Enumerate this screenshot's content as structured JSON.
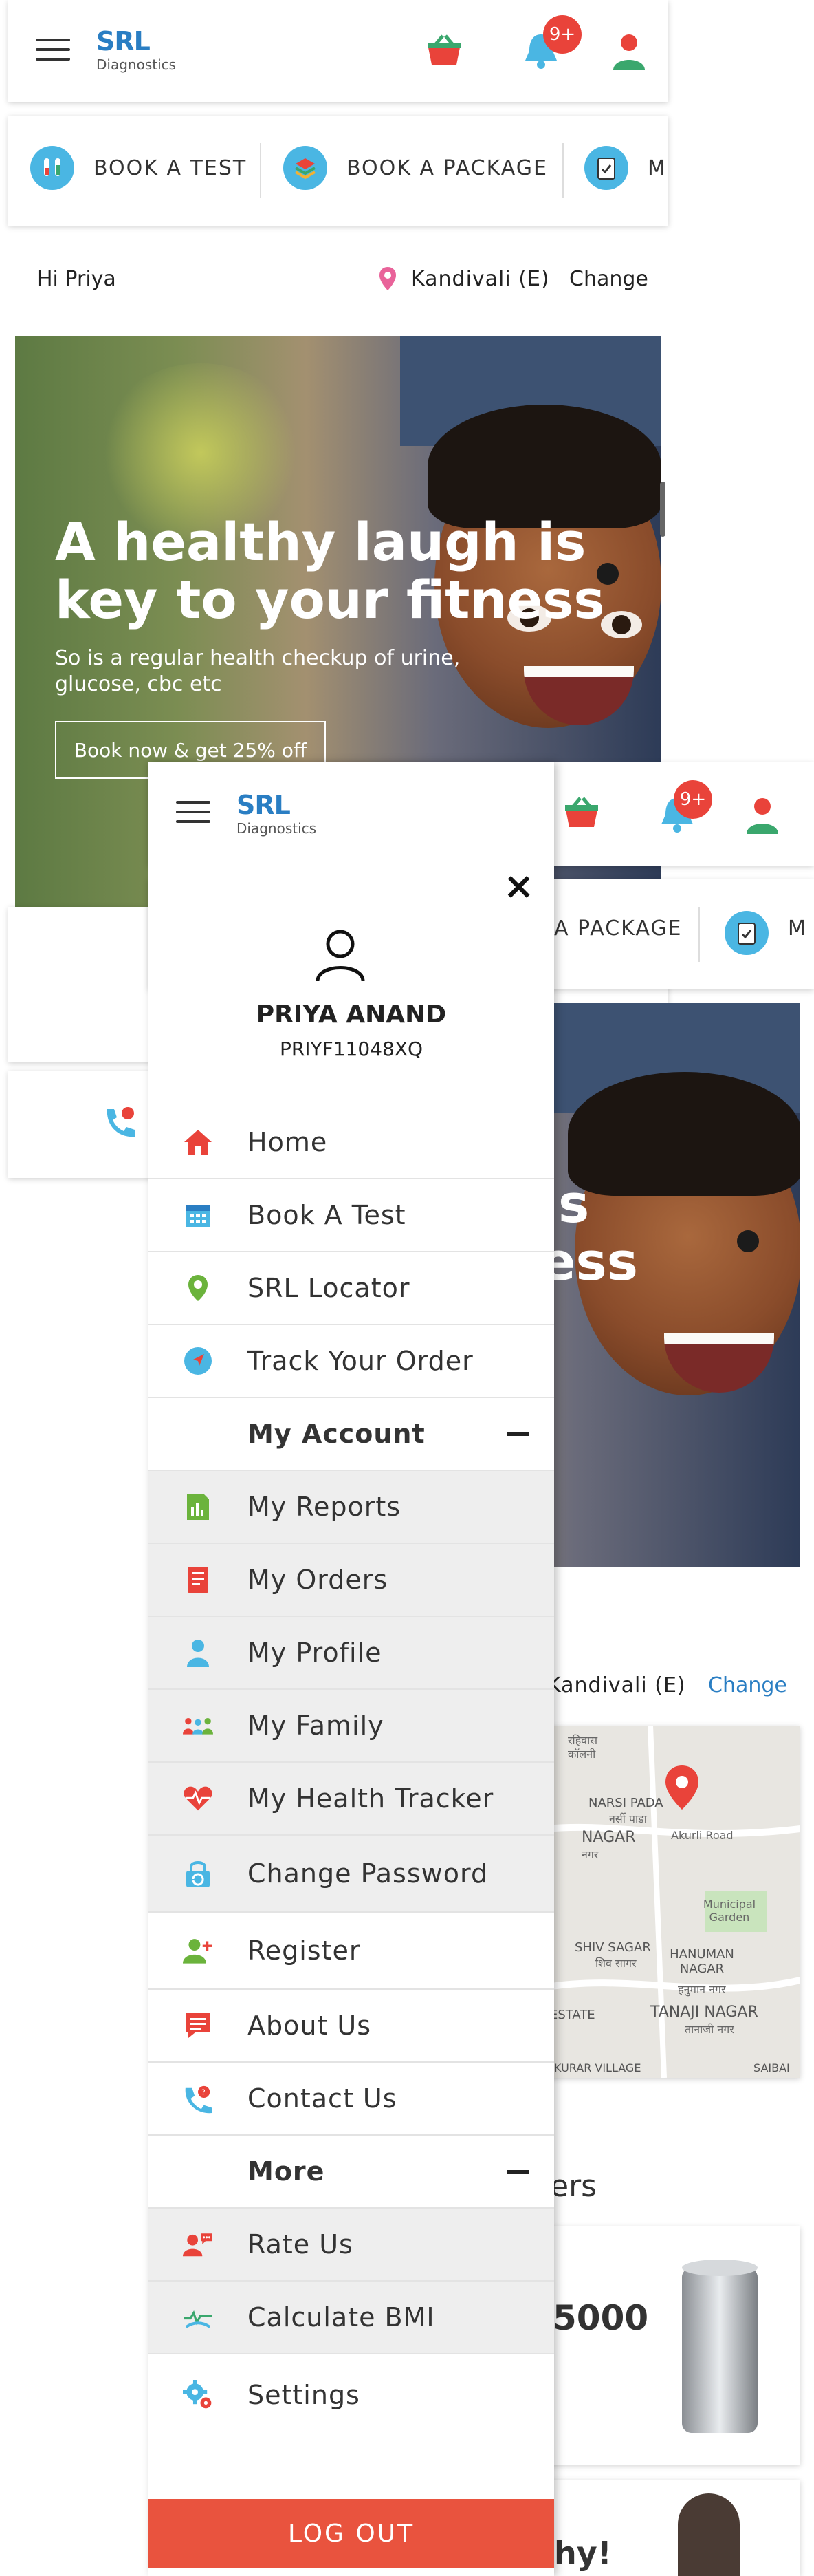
{
  "header": {
    "logo_main": "SRL",
    "logo_sub": "Diagnostics",
    "notification_badge": "9+"
  },
  "quick_links": [
    {
      "label": "BOOK A TEST",
      "icon": "test-tubes-icon"
    },
    {
      "label": "BOOK A PACKAGE",
      "icon": "package-icon"
    },
    {
      "label": "M",
      "icon": "clipboard-icon"
    }
  ],
  "greeting": {
    "text": "Hi Priya",
    "location": "Kandivali (E)",
    "change_label": "Change"
  },
  "hero": {
    "title_line1": "A healthy laugh is",
    "title_line2": "key to your fitness",
    "subtitle_line1": "So is a regular health checkup of urine,",
    "subtitle_line2": "glucose, cbc etc",
    "button_label": "Book now & get 25% off"
  },
  "background_screen": {
    "quick_link_partial": "A PACKAGE",
    "quick_link_partial2": "M",
    "hero_partial1": "is",
    "hero_partial2": "ess",
    "location": "Kandivali (E)",
    "change_label": "Change",
    "map_labels": {
      "narsi_pada": "NARSI PADA",
      "narsi_pada_hi": "नर्सी पाडा",
      "akurli_road": "Akurli Road",
      "nagar": "NAGAR",
      "nagar_hi": "नगर",
      "municipal_garden": "Municipal Garden",
      "shiv_sagar": "SHIV SAGAR",
      "shiv_sagar_hi": "शिव सागर",
      "hanuman_nagar": "HANUMAN NAGAR",
      "hanuman_nagar_hi": "हनुमान नगर",
      "estate": "ESTATE",
      "tanaji_nagar": "TANAJI NAGAR",
      "tanaji_nagar_hi": "तानाजी नगर",
      "kurar_village": "KURAR VILLAGE",
      "saibai": "SAIBAI",
      "colony": "कॉलनी",
      "top_hi": "रहिवास"
    },
    "offers_partial": "ers",
    "offer_amount": "5000",
    "bottom_partial": "hy!"
  },
  "drawer": {
    "close_label": "×",
    "user_name": "PRIYA ANAND",
    "user_id": "PRIYF11048XQ",
    "menu": [
      {
        "label": "Home",
        "icon": "home-icon"
      },
      {
        "label": "Book A Test",
        "icon": "calendar-icon"
      },
      {
        "label": "SRL Locator",
        "icon": "location-pin-icon"
      },
      {
        "label": "Track Your Order",
        "icon": "navigation-icon"
      }
    ],
    "my_account_label": "My Account",
    "account_items": [
      {
        "label": "My Reports",
        "icon": "reports-icon"
      },
      {
        "label": "My Orders",
        "icon": "orders-icon"
      },
      {
        "label": "My Profile",
        "icon": "profile-icon"
      },
      {
        "label": "My Family",
        "icon": "family-icon"
      },
      {
        "label": "My Health Tracker",
        "icon": "health-tracker-icon"
      },
      {
        "label": "Change Password",
        "icon": "change-password-icon"
      }
    ],
    "other_items": [
      {
        "label": "Register",
        "icon": "register-icon"
      },
      {
        "label": "About Us",
        "icon": "about-icon"
      },
      {
        "label": "Contact Us",
        "icon": "contact-icon"
      }
    ],
    "more_label": "More",
    "more_items": [
      {
        "label": "Rate Us",
        "icon": "rate-icon"
      },
      {
        "label": "Calculate BMI",
        "icon": "bmi-icon"
      }
    ],
    "settings_label": "Settings",
    "logout_label": "LOG OUT"
  },
  "colors": {
    "brand_red": "#e9433a",
    "brand_blue": "#4ab6e3",
    "link_blue": "#2a7ec3",
    "logout": "#e9533e"
  }
}
